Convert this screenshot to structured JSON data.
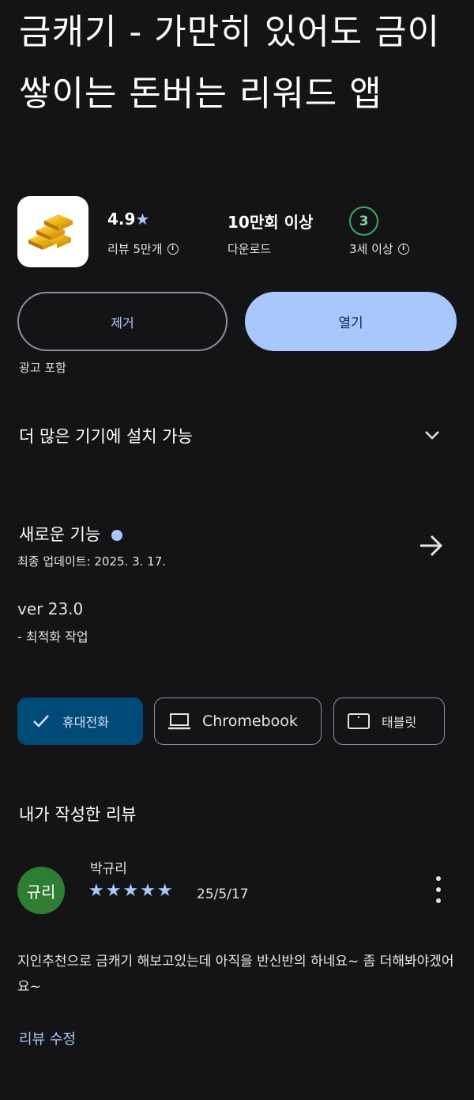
{
  "app": {
    "title": "금캐기 - 가만히 있어도 금이 쌓이는 돈버는 리워드 앱",
    "icon": "gold-bars-icon"
  },
  "stats": {
    "rating": "4.9",
    "reviews_label": "리뷰 5만개",
    "downloads_value": "10만회 이상",
    "downloads_label": "다운로드",
    "age_rating": "3",
    "age_label": "3세 이상"
  },
  "buttons": {
    "uninstall": "제거",
    "open": "열기"
  },
  "ads_notice": "광고 포함",
  "more_devices": "더 많은 기기에 설치 가능",
  "whats_new": {
    "title": "새로운 기능",
    "updated": "최종 업데이트: 2025. 3. 17.",
    "version": "ver 23.0",
    "notes": "- 최적화 작업"
  },
  "device_tabs": [
    {
      "label": "휴대전화",
      "icon": "check-icon",
      "selected": true
    },
    {
      "label": "Chromebook",
      "icon": "laptop-icon",
      "selected": false
    },
    {
      "label": "태블릿",
      "icon": "tablet-icon",
      "selected": false
    }
  ],
  "my_review": {
    "section_title": "내가 작성한 리뷰",
    "avatar_text": "규리",
    "author": "박규리",
    "stars": "★★★★★",
    "date": "25/5/17",
    "text": "지인추천으로 금캐기 해보고있는데 아직을 반신반의 하네요~ 좀 더해봐야겠어요~",
    "edit_label": "리뷰 수정"
  },
  "colors": {
    "background": "#141416",
    "accent": "#a8c7fa",
    "selected_chip": "#004a77",
    "avatar": "#2f7d32",
    "age_badge": "#3ea85a"
  }
}
